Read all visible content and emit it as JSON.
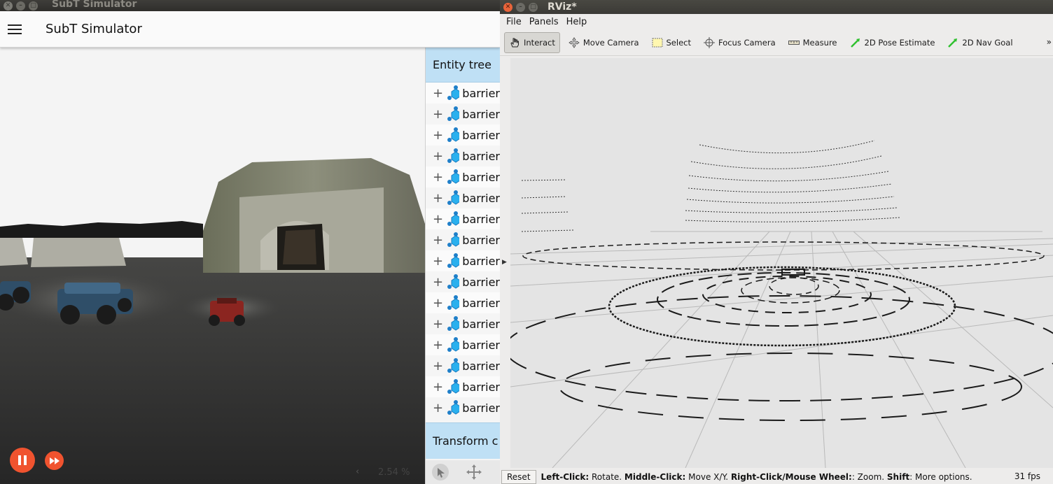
{
  "subt": {
    "window_title": "SubT Simulator",
    "app_title": "SubT Simulator",
    "zoom": "2.54 %",
    "zoom_arrow": "‹",
    "entity_tree": {
      "title": "Entity tree",
      "items": [
        "barrier",
        "barrier",
        "barrier",
        "barrier",
        "barrier",
        "barrier",
        "barrier",
        "barrier",
        "barrier",
        "barrier",
        "barrier",
        "barrier",
        "barrier",
        "barrier",
        "barrier",
        "barrier"
      ]
    },
    "transform_title": "Transform c",
    "accent_color": "#f0532f"
  },
  "rviz": {
    "window_title": "RViz*",
    "menu": [
      "File",
      "Panels",
      "Help"
    ],
    "tools": [
      {
        "label": "Interact",
        "icon": "hand-icon",
        "active": true
      },
      {
        "label": "Move Camera",
        "icon": "move-camera-icon",
        "active": false
      },
      {
        "label": "Select",
        "icon": "select-icon",
        "active": false
      },
      {
        "label": "Focus Camera",
        "icon": "focus-camera-icon",
        "active": false
      },
      {
        "label": "Measure",
        "icon": "ruler-icon",
        "active": false
      },
      {
        "label": "2D Pose Estimate",
        "icon": "pose-arrow-icon",
        "active": false
      },
      {
        "label": "2D Nav Goal",
        "icon": "nav-goal-arrow-icon",
        "active": false
      }
    ],
    "more": "»",
    "status": {
      "reset": "Reset",
      "k1": "Left-Click:",
      "v1": " Rotate. ",
      "k2": "Middle-Click:",
      "v2": " Move X/Y. ",
      "k3": "Right-Click/Mouse Wheel:",
      "v3": ": Zoom. ",
      "k4": "Shift",
      "v4": ": More options.",
      "fps": "31 fps"
    }
  }
}
